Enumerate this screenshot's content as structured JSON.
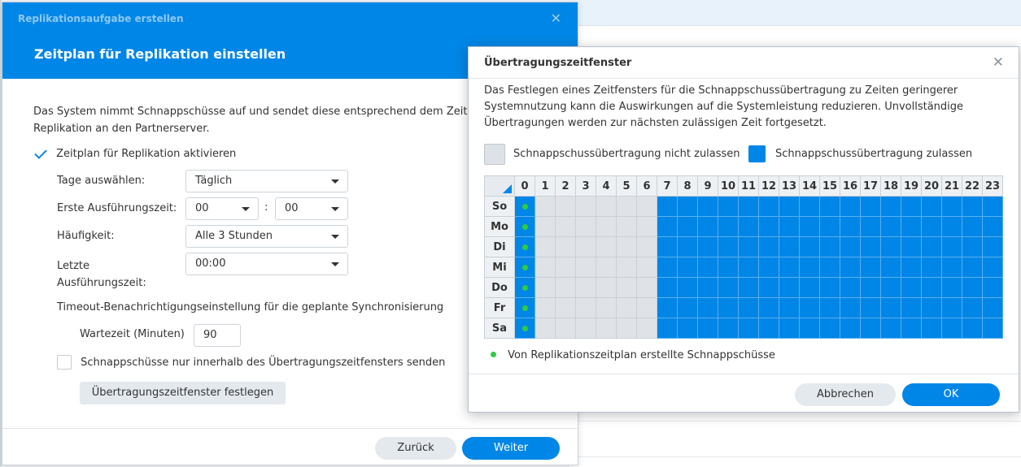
{
  "wizard": {
    "window_title": "Replikationsaufgabe erstellen",
    "step_title": "Zeitplan für Replikation einstellen",
    "description_line1": "Das System nimmt Schnappschüsse auf und sendet diese entsprechend dem Zeitplan der",
    "description_line2": "Replikation an den Partnerserver.",
    "enable_schedule_label": "Zeitplan für Replikation aktivieren",
    "enable_schedule_checked": true,
    "days_label": "Tage auswählen:",
    "days_value": "Täglich",
    "first_run_label": "Erste Ausführungszeit:",
    "first_run_hour": "00",
    "first_run_minute": "00",
    "time_separator": ":",
    "frequency_label": "Häufigkeit:",
    "frequency_value": "Alle 3 Stunden",
    "last_run_label_1": "Letzte",
    "last_run_label_2": "Ausführungszeit:",
    "last_run_value": "00:00",
    "timeout_heading": "Timeout-Benachrichtigungseinstellung für die geplante Synchronisierung",
    "wait_label": "Wartezeit (Minuten)",
    "wait_value": "90",
    "window_only_label": "Schnappschüsse nur innerhalb des Übertragungszeitfensters senden",
    "window_only_checked": false,
    "set_window_button": "Übertragungszeitfenster festlegen",
    "back_button": "Zurück",
    "next_button": "Weiter"
  },
  "transfer_window": {
    "title": "Übertragungszeitfenster",
    "description_line1": "Das Festlegen eines Zeitfensters für die Schnappschussübertragung zu Zeiten geringerer",
    "description_line2": "Systemnutzung kann die Auswirkungen auf die Systemleistung reduzieren. Unvollständige",
    "description_line3": "Übertragungen werden zur nächsten zulässigen Zeit fortgesetzt.",
    "legend_disallow": "Schnappschussübertragung nicht zulassen",
    "legend_allow": "Schnappschussübertragung zulassen",
    "hours": [
      "0",
      "1",
      "2",
      "3",
      "4",
      "5",
      "6",
      "7",
      "8",
      "9",
      "10",
      "11",
      "12",
      "13",
      "14",
      "15",
      "16",
      "17",
      "18",
      "19",
      "20",
      "21",
      "22",
      "23"
    ],
    "days": [
      "So",
      "Mo",
      "Di",
      "Mi",
      "Do",
      "Fr",
      "Sa"
    ],
    "allowed_hours": [
      0,
      7,
      8,
      9,
      10,
      11,
      12,
      13,
      14,
      15,
      16,
      17,
      18,
      19,
      20,
      21,
      22,
      23
    ],
    "snapshot_hours": [
      0
    ],
    "note": "Von Replikationszeitplan erstellte Schnappschüsse",
    "cancel_button": "Abbrechen",
    "ok_button": "OK",
    "colors": {
      "allowed": "#0086e6",
      "disallowed": "#dfe3e7",
      "snapshot_dot": "#2ecc40"
    }
  }
}
